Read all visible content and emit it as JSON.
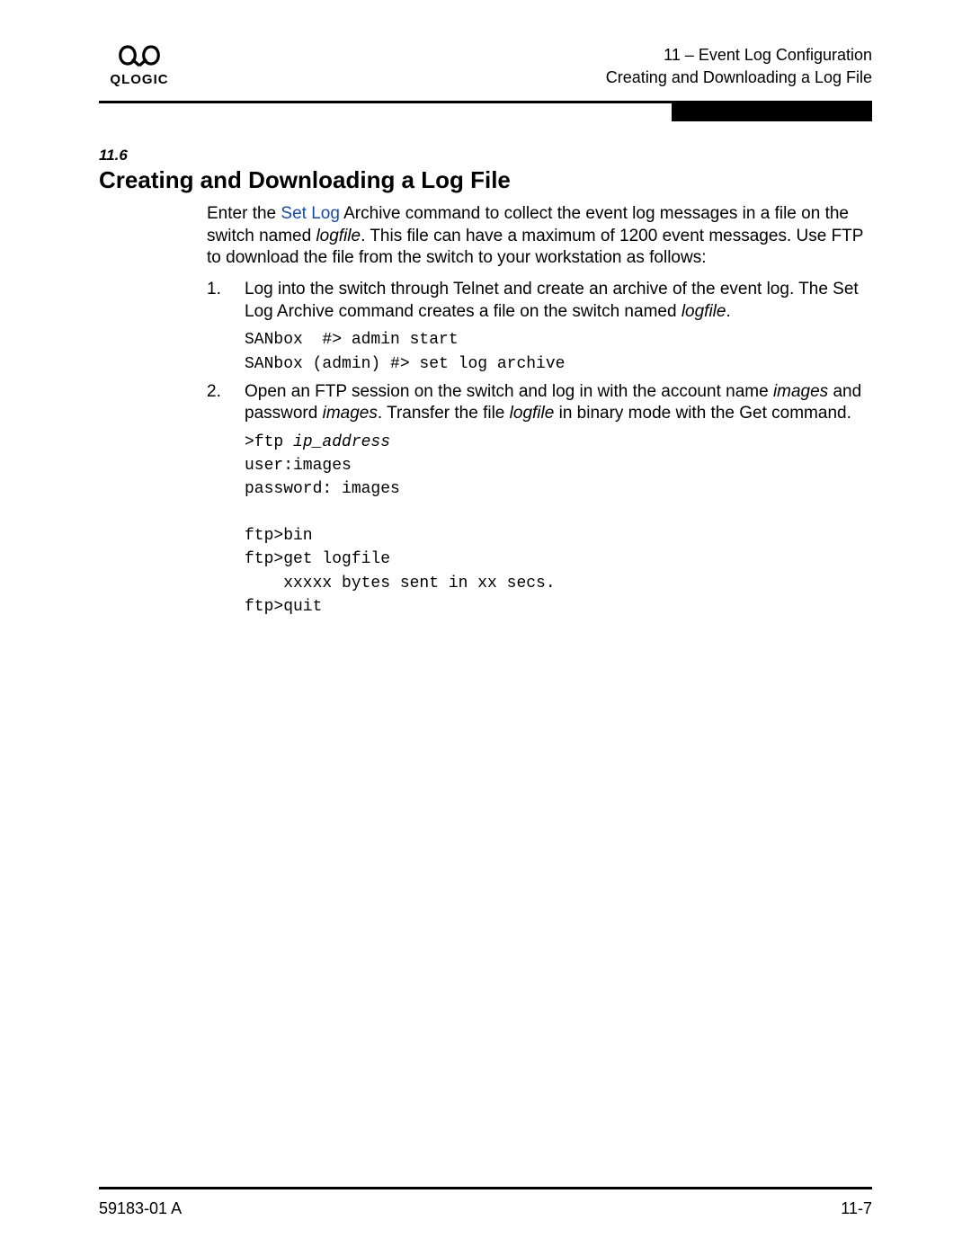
{
  "header": {
    "logo_alt": "QLOGIC",
    "chapter_line": "11 – Event Log Configuration",
    "subtitle": "Creating and Downloading a Log File"
  },
  "section": {
    "number": "11.6",
    "title": "Creating and Downloading a Log File",
    "intro_pre": "Enter the ",
    "intro_link": "Set Log",
    "intro_mid1": " Archive command to collect the event log messages in a file on the switch named ",
    "intro_em1": "logfile",
    "intro_post": ". This file can have a maximum of 1200 event messages. Use FTP to download the file from the switch to your workstation as follows:"
  },
  "steps": {
    "s1_a": "Log into the switch through Telnet and create an archive of the event log. The Set Log Archive command creates a file on the switch named ",
    "s1_em": "logfile",
    "s1_b": ".",
    "s1_code": "SANbox  #> admin start\nSANbox (admin) #> set log archive",
    "s2_a": "Open an FTP session on the switch and log in with the account name ",
    "s2_em1": "images",
    "s2_b": " and password ",
    "s2_em2": "images",
    "s2_c": ". Transfer the file ",
    "s2_em3": "logfile",
    "s2_d": " in binary mode with the Get command.",
    "s2_code1_a": ">ftp ",
    "s2_code1_b": "ip_address",
    "s2_code2": "user:images\npassword: images\n\nftp>bin\nftp>get logfile\n    xxxxx bytes sent in xx secs.\nftp>quit"
  },
  "footer": {
    "left": "59183-01 A",
    "right": "11-7"
  }
}
